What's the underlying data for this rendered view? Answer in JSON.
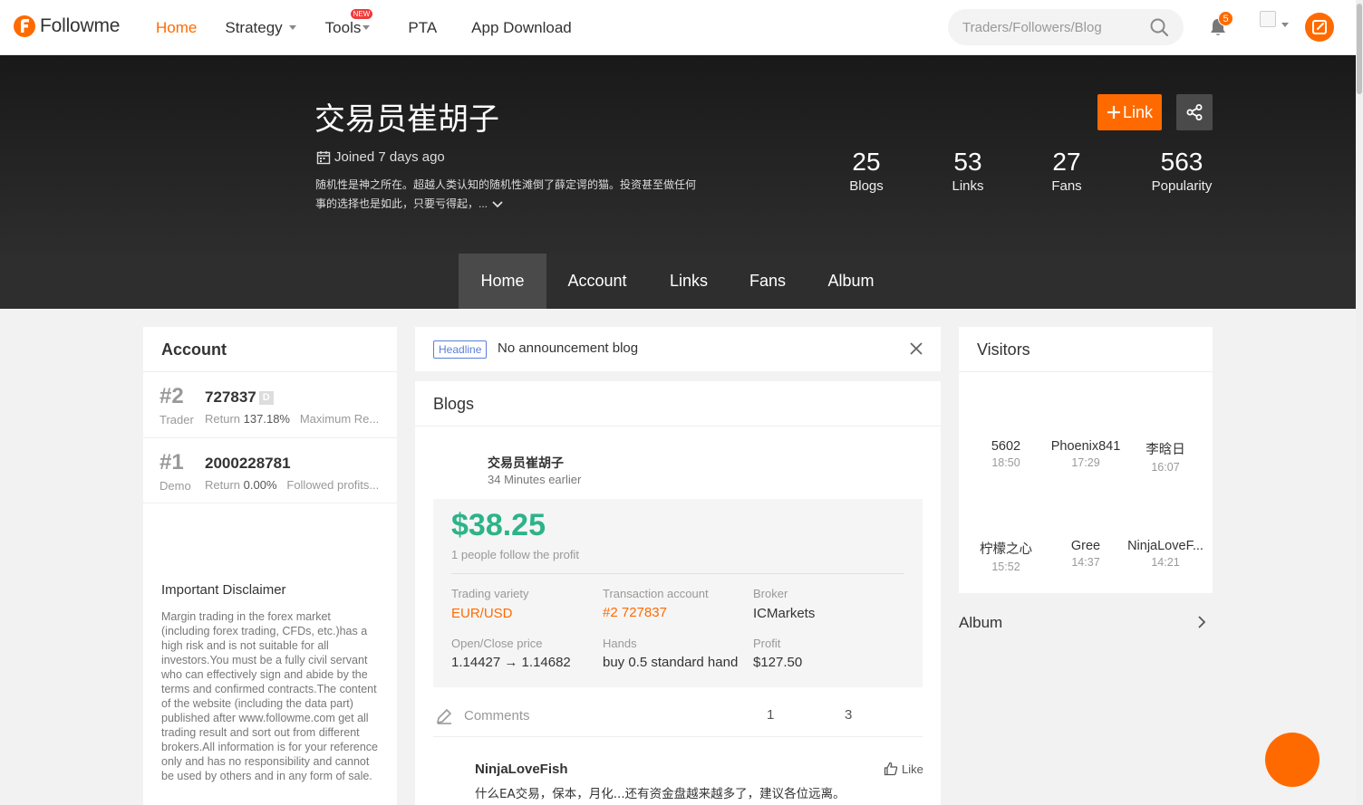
{
  "header": {
    "brand": "Followme",
    "nav": [
      {
        "label": "Home",
        "active": true
      },
      {
        "label": "Strategy",
        "has_caret": true
      },
      {
        "label": "Tools",
        "has_caret": true,
        "badge": "NEW"
      },
      {
        "label": "PTA"
      },
      {
        "label": "App Download"
      }
    ],
    "search_placeholder": "Traders/Followers/Blog",
    "notification_count": "5",
    "accent_color": "#ff6a00"
  },
  "profile": {
    "name": "交易员崔胡子",
    "joined": "Joined 7 days ago",
    "bio_line1": "随机性是神之所在。超越人类认知的随机性滩倒了薛定谔的猫。投资甚至做任何",
    "bio_line2": "事的选择也是如此，只要亏得起，...",
    "link_button": "Link",
    "stats": [
      {
        "value": "25",
        "label": "Blogs"
      },
      {
        "value": "53",
        "label": "Links"
      },
      {
        "value": "27",
        "label": "Fans"
      },
      {
        "value": "563",
        "label": "Popularity"
      }
    ]
  },
  "tabs": [
    {
      "label": "Home",
      "active": true
    },
    {
      "label": "Account"
    },
    {
      "label": "Links"
    },
    {
      "label": "Fans"
    },
    {
      "label": "Album"
    }
  ],
  "account_panel": {
    "title": "Account",
    "accounts": [
      {
        "rank": "#2",
        "role": "Trader",
        "id": "727837",
        "tag": "D",
        "return_label": "Return",
        "return_value": "137.18%",
        "extra": "Maximum Re..."
      },
      {
        "rank": "#1",
        "role": "Demo",
        "id": "2000228781",
        "return_label": "Return",
        "return_value": "0.00%",
        "extra": "Followed profits..."
      }
    ],
    "disclaimer_title": "Important Disclaimer",
    "disclaimer_body": "Margin trading in the forex market (including forex trading, CFDs, etc.)has a high risk and is not suitable for all investors.You must be a fully civil servant who can effectively sign and abide by the terms and confirmed contracts.The content of the website (including the data part) published after www.followme.com get all trading result and sort out from different brokers.All information is for your reference only and has no responsibility and cannot be used by others and in any form of sale."
  },
  "headline": {
    "tag": "Headline",
    "text": "No announcement blog"
  },
  "blogs": {
    "title": "Blogs",
    "post": {
      "author": "交易员崔胡子",
      "time": "34 Minutes earlier",
      "profit": "$38.25",
      "profit_note": "1 people follow the profit",
      "fields": [
        {
          "label": "Trading variety",
          "value": "EUR/USD",
          "highlight": true
        },
        {
          "label": "Transaction account",
          "value": "#2 727837",
          "highlight": true
        },
        {
          "label": "Broker",
          "value": "ICMarkets"
        },
        {
          "label": "Open/Close price",
          "value": "1.14427 → 1.14682"
        },
        {
          "label": "Hands",
          "value": "buy 0.5 standard hand"
        },
        {
          "label": "Profit",
          "value": "$127.50"
        }
      ],
      "comments_label": "Comments",
      "count_a": "1",
      "count_b": "3"
    },
    "comment": {
      "user": "NinjaLoveFish",
      "text": "什么EA交易，保本，月化...还有资金盘越来越多了，建议各位远离。",
      "like_label": "Like"
    }
  },
  "visitors": {
    "title": "Visitors",
    "items": [
      {
        "name": "5602",
        "time": "18:50"
      },
      {
        "name": "Phoenix841",
        "time": "17:29"
      },
      {
        "name": "李晗日",
        "time": "16:07"
      },
      {
        "name": "柠檬之心",
        "time": "15:52"
      },
      {
        "name": "Gree",
        "time": "14:37"
      },
      {
        "name": "NinjaLoveF...",
        "time": "14:21"
      }
    ]
  },
  "album": {
    "title": "Album"
  }
}
